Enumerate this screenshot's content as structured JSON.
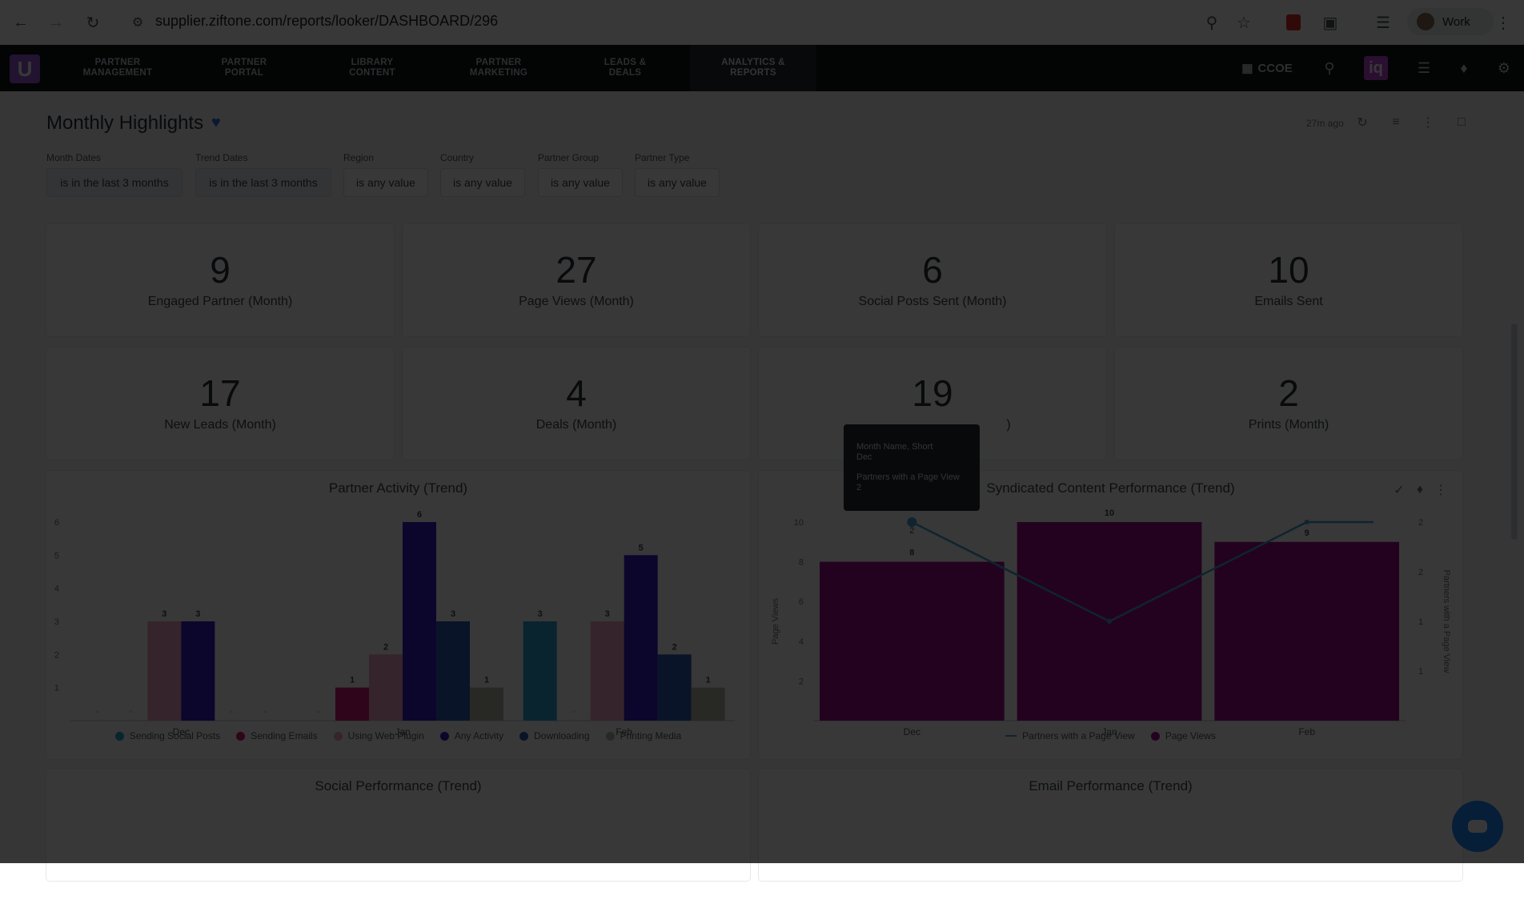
{
  "browser": {
    "url": "supplier.ziftone.com/reports/looker/DASHBOARD/296",
    "profile_name": "Work"
  },
  "app": {
    "logo_letter": "U",
    "nav": [
      {
        "line1": "PARTNER",
        "line2": "MANAGEMENT"
      },
      {
        "line1": "PARTNER",
        "line2": "PORTAL"
      },
      {
        "line1": "LIBRARY",
        "line2": "CONTENT"
      },
      {
        "line1": "PARTNER",
        "line2": "MARKETING"
      },
      {
        "line1": "LEADS &",
        "line2": "DEALS"
      },
      {
        "line1": "ANALYTICS &",
        "line2": "REPORTS"
      }
    ],
    "org": "CCOE",
    "iq": "iq"
  },
  "dashboard": {
    "title": "Monthly Highlights",
    "updated": "27m ago",
    "filters": [
      {
        "label": "Month Dates",
        "value": "is in the last 3 months"
      },
      {
        "label": "Trend Dates",
        "value": "is in the last 3 months"
      },
      {
        "label": "Region",
        "value": "is any value"
      },
      {
        "label": "Country",
        "value": "is any value"
      },
      {
        "label": "Partner Group",
        "value": "is any value"
      },
      {
        "label": "Partner Type",
        "value": "is any value"
      }
    ],
    "kpis": [
      {
        "value": "9",
        "label": "Engaged Partner (Month)"
      },
      {
        "value": "27",
        "label": "Page Views (Month)"
      },
      {
        "value": "6",
        "label": "Social Posts Sent (Month)"
      },
      {
        "value": "10",
        "label": "Emails Sent"
      },
      {
        "value": "17",
        "label": "New Leads (Month)"
      },
      {
        "value": "4",
        "label": "Deals (Month)"
      },
      {
        "value": "19",
        "label": ")"
      },
      {
        "value": "2",
        "label": "Prints (Month)"
      }
    ],
    "tooltip": {
      "line1": "Month Name, Short",
      "line2": "Dec",
      "line3": "Partners with a Page View",
      "line4": "2"
    },
    "bottom_titles": [
      "Social Performance (Trend)",
      "Email Performance (Trend)"
    ]
  },
  "chart_data": [
    {
      "type": "bar",
      "title": "Partner Activity (Trend)",
      "categories": [
        "Dec",
        "Jan",
        "Feb"
      ],
      "ylim": [
        0,
        6
      ],
      "yticks": [
        1,
        2,
        3,
        4,
        5,
        6
      ],
      "series": [
        {
          "name": "Sending Social Posts",
          "color": "#2ba3d6",
          "values": [
            0,
            0,
            3
          ]
        },
        {
          "name": "Sending Emails",
          "color": "#d6187a",
          "values": [
            0,
            1,
            0
          ]
        },
        {
          "name": "Using Web Plugin",
          "color": "#f4a6c6",
          "values": [
            3,
            2,
            3
          ]
        },
        {
          "name": "Any Activity",
          "color": "#3a1fc8",
          "values": [
            3,
            6,
            5
          ]
        },
        {
          "name": "Downloading",
          "color": "#2b5bb5",
          "values": [
            0,
            3,
            2
          ]
        },
        {
          "name": "Printing Media",
          "color": "#b7bca9",
          "values": [
            0,
            1,
            1
          ]
        }
      ]
    },
    {
      "type": "bar",
      "title": "Syndicated Content Performance (Trend)",
      "categories": [
        "Dec",
        "Jan",
        "Feb"
      ],
      "ylabel": "Page Views",
      "y2label": "Partners with a Page View",
      "ylim": [
        0,
        10
      ],
      "yticks": [
        2,
        4,
        6,
        8,
        10
      ],
      "y2lim": [
        0,
        2
      ],
      "y2ticks": [
        "1",
        "1",
        "2",
        "2"
      ],
      "series": [
        {
          "name": "Page Views",
          "type": "bar",
          "color": "#a10a8c",
          "values": [
            8,
            10,
            9
          ]
        },
        {
          "name": "Partners with a Page View",
          "type": "line",
          "color": "#3fa6d6",
          "values": [
            2,
            1,
            2
          ]
        }
      ],
      "line_labels": [
        "2",
        "1",
        ""
      ]
    }
  ]
}
